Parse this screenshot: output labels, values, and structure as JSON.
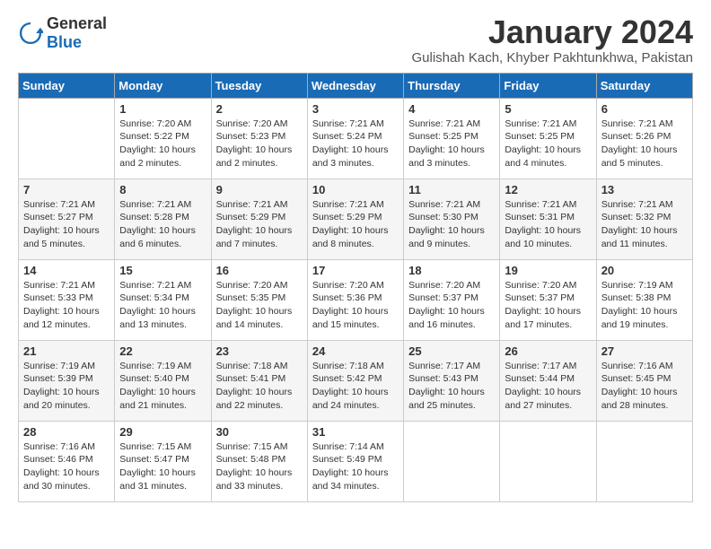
{
  "logo": {
    "general": "General",
    "blue": "Blue"
  },
  "title": "January 2024",
  "subtitle": "Gulishah Kach, Khyber Pakhtunkhwa, Pakistan",
  "headers": [
    "Sunday",
    "Monday",
    "Tuesday",
    "Wednesday",
    "Thursday",
    "Friday",
    "Saturday"
  ],
  "weeks": [
    [
      {
        "day": "",
        "info": ""
      },
      {
        "day": "1",
        "info": "Sunrise: 7:20 AM\nSunset: 5:22 PM\nDaylight: 10 hours\nand 2 minutes."
      },
      {
        "day": "2",
        "info": "Sunrise: 7:20 AM\nSunset: 5:23 PM\nDaylight: 10 hours\nand 2 minutes."
      },
      {
        "day": "3",
        "info": "Sunrise: 7:21 AM\nSunset: 5:24 PM\nDaylight: 10 hours\nand 3 minutes."
      },
      {
        "day": "4",
        "info": "Sunrise: 7:21 AM\nSunset: 5:25 PM\nDaylight: 10 hours\nand 3 minutes."
      },
      {
        "day": "5",
        "info": "Sunrise: 7:21 AM\nSunset: 5:25 PM\nDaylight: 10 hours\nand 4 minutes."
      },
      {
        "day": "6",
        "info": "Sunrise: 7:21 AM\nSunset: 5:26 PM\nDaylight: 10 hours\nand 5 minutes."
      }
    ],
    [
      {
        "day": "7",
        "info": "Sunrise: 7:21 AM\nSunset: 5:27 PM\nDaylight: 10 hours\nand 5 minutes."
      },
      {
        "day": "8",
        "info": "Sunrise: 7:21 AM\nSunset: 5:28 PM\nDaylight: 10 hours\nand 6 minutes."
      },
      {
        "day": "9",
        "info": "Sunrise: 7:21 AM\nSunset: 5:29 PM\nDaylight: 10 hours\nand 7 minutes."
      },
      {
        "day": "10",
        "info": "Sunrise: 7:21 AM\nSunset: 5:29 PM\nDaylight: 10 hours\nand 8 minutes."
      },
      {
        "day": "11",
        "info": "Sunrise: 7:21 AM\nSunset: 5:30 PM\nDaylight: 10 hours\nand 9 minutes."
      },
      {
        "day": "12",
        "info": "Sunrise: 7:21 AM\nSunset: 5:31 PM\nDaylight: 10 hours\nand 10 minutes."
      },
      {
        "day": "13",
        "info": "Sunrise: 7:21 AM\nSunset: 5:32 PM\nDaylight: 10 hours\nand 11 minutes."
      }
    ],
    [
      {
        "day": "14",
        "info": "Sunrise: 7:21 AM\nSunset: 5:33 PM\nDaylight: 10 hours\nand 12 minutes."
      },
      {
        "day": "15",
        "info": "Sunrise: 7:21 AM\nSunset: 5:34 PM\nDaylight: 10 hours\nand 13 minutes."
      },
      {
        "day": "16",
        "info": "Sunrise: 7:20 AM\nSunset: 5:35 PM\nDaylight: 10 hours\nand 14 minutes."
      },
      {
        "day": "17",
        "info": "Sunrise: 7:20 AM\nSunset: 5:36 PM\nDaylight: 10 hours\nand 15 minutes."
      },
      {
        "day": "18",
        "info": "Sunrise: 7:20 AM\nSunset: 5:37 PM\nDaylight: 10 hours\nand 16 minutes."
      },
      {
        "day": "19",
        "info": "Sunrise: 7:20 AM\nSunset: 5:37 PM\nDaylight: 10 hours\nand 17 minutes."
      },
      {
        "day": "20",
        "info": "Sunrise: 7:19 AM\nSunset: 5:38 PM\nDaylight: 10 hours\nand 19 minutes."
      }
    ],
    [
      {
        "day": "21",
        "info": "Sunrise: 7:19 AM\nSunset: 5:39 PM\nDaylight: 10 hours\nand 20 minutes."
      },
      {
        "day": "22",
        "info": "Sunrise: 7:19 AM\nSunset: 5:40 PM\nDaylight: 10 hours\nand 21 minutes."
      },
      {
        "day": "23",
        "info": "Sunrise: 7:18 AM\nSunset: 5:41 PM\nDaylight: 10 hours\nand 22 minutes."
      },
      {
        "day": "24",
        "info": "Sunrise: 7:18 AM\nSunset: 5:42 PM\nDaylight: 10 hours\nand 24 minutes."
      },
      {
        "day": "25",
        "info": "Sunrise: 7:17 AM\nSunset: 5:43 PM\nDaylight: 10 hours\nand 25 minutes."
      },
      {
        "day": "26",
        "info": "Sunrise: 7:17 AM\nSunset: 5:44 PM\nDaylight: 10 hours\nand 27 minutes."
      },
      {
        "day": "27",
        "info": "Sunrise: 7:16 AM\nSunset: 5:45 PM\nDaylight: 10 hours\nand 28 minutes."
      }
    ],
    [
      {
        "day": "28",
        "info": "Sunrise: 7:16 AM\nSunset: 5:46 PM\nDaylight: 10 hours\nand 30 minutes."
      },
      {
        "day": "29",
        "info": "Sunrise: 7:15 AM\nSunset: 5:47 PM\nDaylight: 10 hours\nand 31 minutes."
      },
      {
        "day": "30",
        "info": "Sunrise: 7:15 AM\nSunset: 5:48 PM\nDaylight: 10 hours\nand 33 minutes."
      },
      {
        "day": "31",
        "info": "Sunrise: 7:14 AM\nSunset: 5:49 PM\nDaylight: 10 hours\nand 34 minutes."
      },
      {
        "day": "",
        "info": ""
      },
      {
        "day": "",
        "info": ""
      },
      {
        "day": "",
        "info": ""
      }
    ]
  ]
}
